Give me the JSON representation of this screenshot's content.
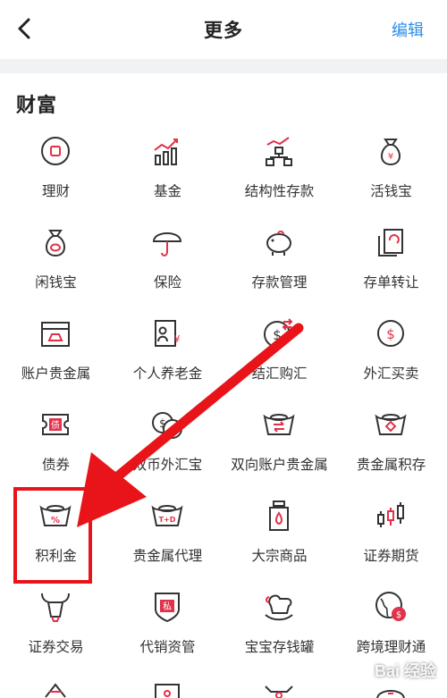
{
  "nav": {
    "title": "更多",
    "edit_label": "编辑"
  },
  "section": {
    "title": "财富"
  },
  "items": [
    {
      "label": "理财",
      "icon": "wealth-circle-icon"
    },
    {
      "label": "基金",
      "icon": "fund-chart-icon"
    },
    {
      "label": "结构性存款",
      "icon": "structured-deposit-icon"
    },
    {
      "label": "活钱宝",
      "icon": "money-bag-yen-icon"
    },
    {
      "label": "闲钱宝",
      "icon": "money-bag-icon"
    },
    {
      "label": "保险",
      "icon": "umbrella-icon"
    },
    {
      "label": "存款管理",
      "icon": "piggy-bank-icon"
    },
    {
      "label": "存单转让",
      "icon": "certificate-transfer-icon"
    },
    {
      "label": "账户贵金属",
      "icon": "gold-box-icon"
    },
    {
      "label": "个人养老金",
      "icon": "pension-icon"
    },
    {
      "label": "结汇购汇",
      "icon": "currency-exchange-icon"
    },
    {
      "label": "外汇买卖",
      "icon": "forex-trade-icon"
    },
    {
      "label": "债券",
      "icon": "bond-ticket-icon"
    },
    {
      "label": "双币外汇宝",
      "icon": "dual-currency-icon"
    },
    {
      "label": "双向账户贵金属",
      "icon": "gold-ingot-exchange-icon"
    },
    {
      "label": "贵金属积存",
      "icon": "gold-ingot-accumulate-icon"
    },
    {
      "label": "积利金",
      "icon": "gold-ingot-percent-icon"
    },
    {
      "label": "贵金属代理",
      "icon": "gold-ingot-td-icon"
    },
    {
      "label": "大宗商品",
      "icon": "oil-canister-icon"
    },
    {
      "label": "证券期货",
      "icon": "candlestick-icon"
    },
    {
      "label": "证券交易",
      "icon": "bull-icon"
    },
    {
      "label": "代销资管",
      "icon": "private-shield-icon"
    },
    {
      "label": "宝宝存钱罐",
      "icon": "rocking-horse-icon"
    },
    {
      "label": "跨境理财通",
      "icon": "globe-dollar-icon"
    }
  ],
  "annotation": {
    "highlighted_item": "积利金"
  },
  "watermark": "Bai 经验",
  "colors": {
    "accent": "#2a8ee8",
    "icon_red": "#e2314a",
    "icon_dark": "#333333",
    "annotation_red": "#e8141a"
  }
}
